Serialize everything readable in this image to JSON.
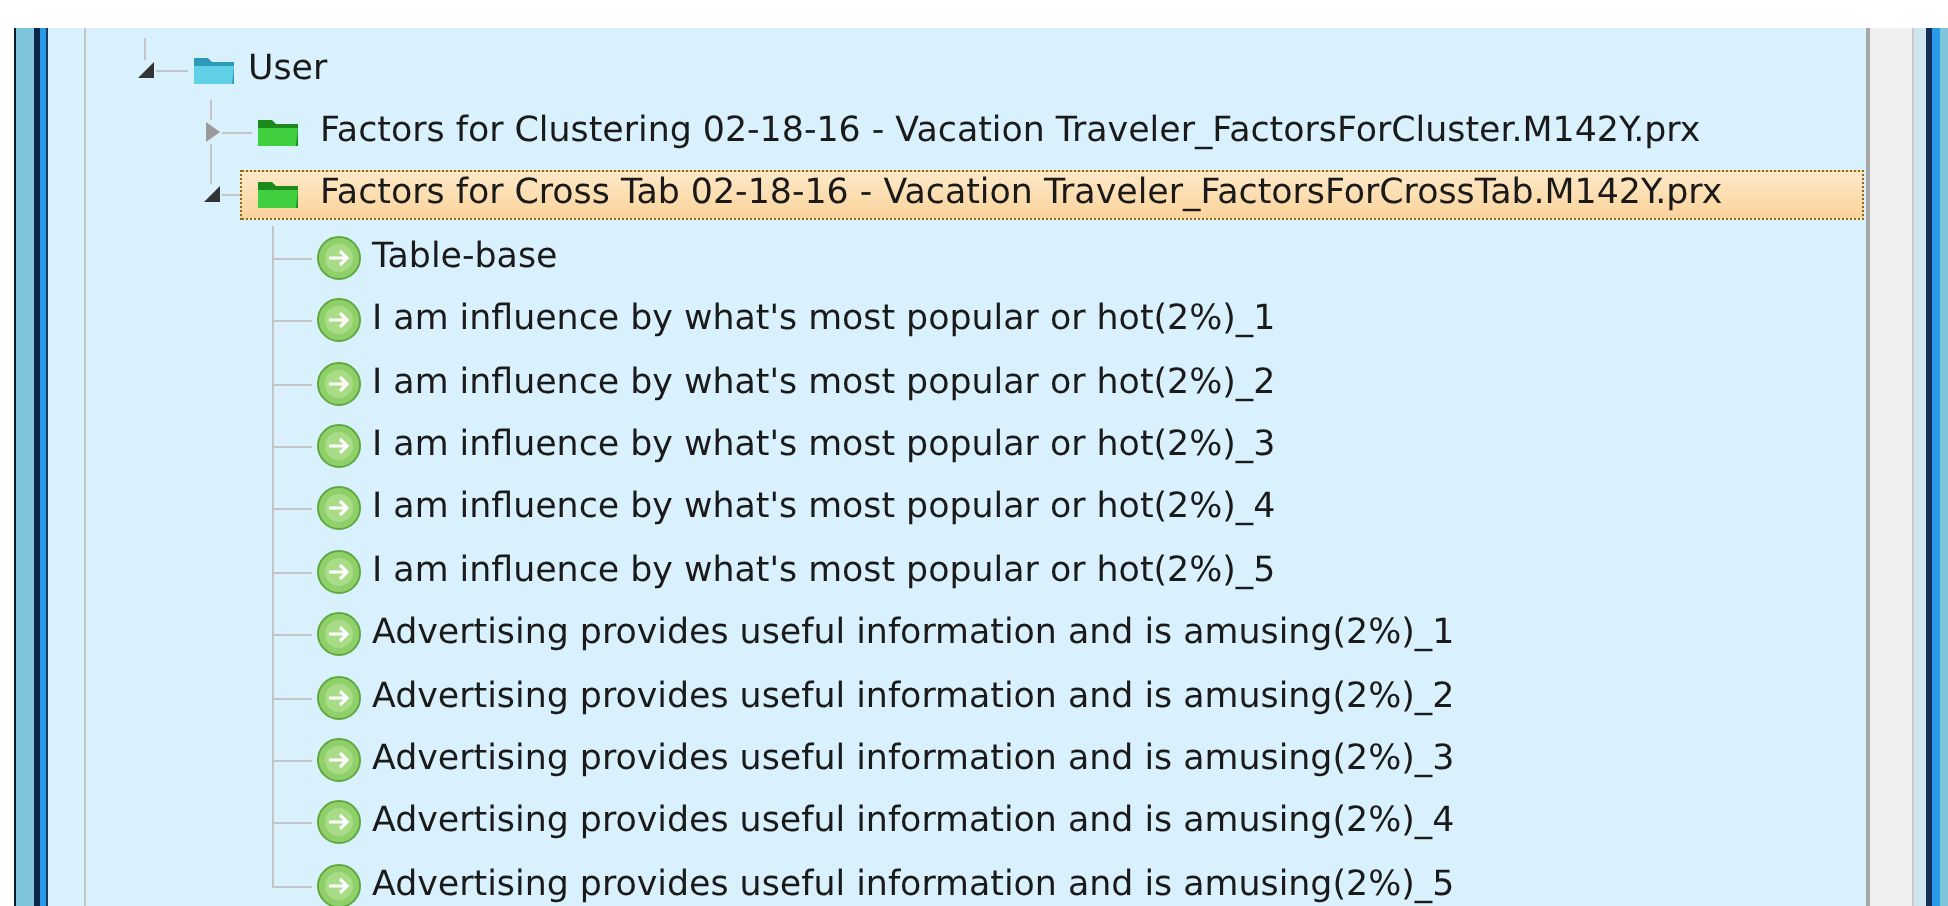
{
  "tree": [
    {
      "label": "User",
      "kind": "folder",
      "expanded": true,
      "selected": false,
      "children": [
        {
          "label": "Factors for Clustering 02-18-16 - Vacation Traveler_FactorsForCluster.M142Y.prx",
          "kind": "file",
          "expanded": false,
          "selected": false
        },
        {
          "label": "Factors for Cross Tab 02-18-16 - Vacation Traveler_FactorsForCrossTab.M142Y.prx",
          "kind": "file",
          "expanded": true,
          "selected": true,
          "children": [
            {
              "label": "Table-base",
              "kind": "variable",
              "selected": false
            },
            {
              "label": "I am influence by what's most popular or hot(2%)_1",
              "kind": "variable",
              "selected": false
            },
            {
              "label": "I am influence by what's most popular or hot(2%)_2",
              "kind": "variable",
              "selected": false
            },
            {
              "label": "I am influence by what's most popular or hot(2%)_3",
              "kind": "variable",
              "selected": false
            },
            {
              "label": "I am influence by what's most popular or hot(2%)_4",
              "kind": "variable",
              "selected": false
            },
            {
              "label": "I am influence by what's most popular or hot(2%)_5",
              "kind": "variable",
              "selected": false
            },
            {
              "label": "Advertising provides useful information and is amusing(2%)_1",
              "kind": "variable",
              "selected": false
            },
            {
              "label": "Advertising provides useful information and is amusing(2%)_2",
              "kind": "variable",
              "selected": false
            },
            {
              "label": "Advertising provides useful information and is amusing(2%)_3",
              "kind": "variable",
              "selected": false
            },
            {
              "label": "Advertising provides useful information and is amusing(2%)_4",
              "kind": "variable",
              "selected": false
            },
            {
              "label": "Advertising provides useful information and is amusing(2%)_5",
              "kind": "variable",
              "selected": false
            }
          ]
        }
      ]
    }
  ]
}
